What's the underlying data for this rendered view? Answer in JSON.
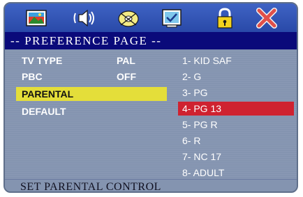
{
  "title": "-- PREFERENCE PAGE --",
  "icons": [
    "tv-picture-icon",
    "audio-speaker-icon",
    "disc-icon",
    "preference-check-icon",
    "lock-icon",
    "close-icon"
  ],
  "menu": [
    {
      "label": "TV TYPE",
      "value": "PAL"
    },
    {
      "label": "PBC",
      "value": "OFF"
    },
    {
      "label": "PARENTAL",
      "value": ""
    },
    {
      "label": "DEFAULT",
      "value": ""
    }
  ],
  "options": [
    "1- KID SAF",
    "2- G",
    "3- PG",
    "4- PG 13",
    "5- PG R",
    "6- R",
    "7- NC 17",
    "8- ADULT"
  ],
  "selected_option": "4- PG 13",
  "status": "SET PARENTAL CONTROL",
  "colors": {
    "highlight_menu": "#e4de3a",
    "highlight_option": "#cf2230",
    "title_bg": "#0a0a7a"
  }
}
